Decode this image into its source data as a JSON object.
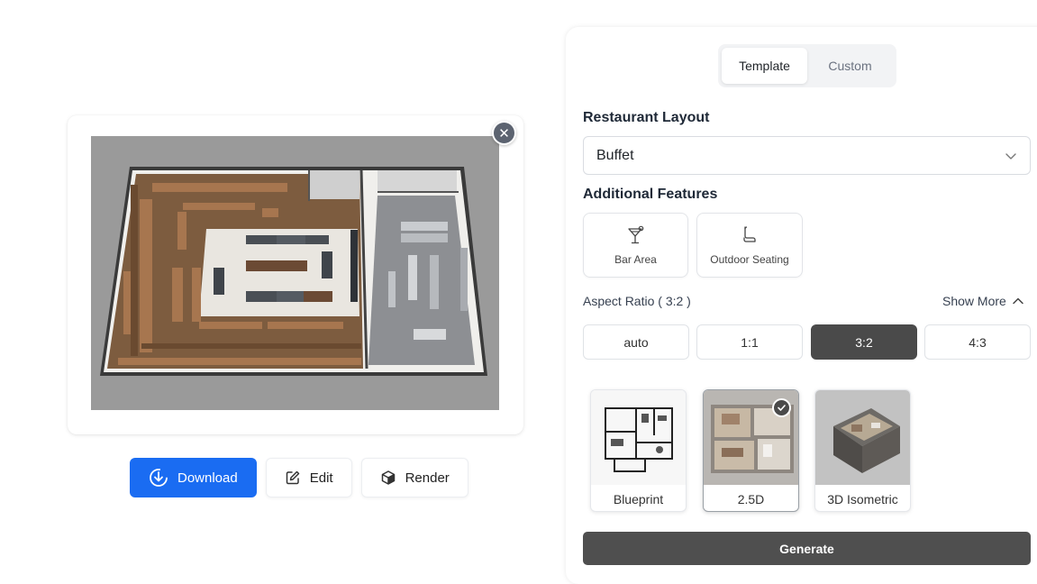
{
  "preview": {
    "image_name": "restaurant-floor-plan-3d-render",
    "close_icon": "close-icon"
  },
  "actions": {
    "download": {
      "label": "Download",
      "icon": "download-icon",
      "color": "#1a6cf2"
    },
    "edit": {
      "label": "Edit",
      "icon": "edit-icon"
    },
    "render": {
      "label": "Render",
      "icon": "cube-icon"
    }
  },
  "tabs": [
    {
      "label": "Template",
      "active": true
    },
    {
      "label": "Custom",
      "active": false
    }
  ],
  "layout_section": {
    "title": "Restaurant Layout",
    "selected": "Buffet",
    "icon": "chevron-down-icon"
  },
  "features_section": {
    "title": "Additional Features",
    "items": [
      {
        "label": "Bar Area",
        "icon": "cocktail-icon"
      },
      {
        "label": "Outdoor Seating",
        "icon": "chair-icon"
      }
    ]
  },
  "aspect_ratio": {
    "label": "Aspect Ratio ( 3:2 )",
    "show_more": "Show More",
    "options": [
      "auto",
      "1:1",
      "3:2",
      "4:3"
    ],
    "selected": "3:2"
  },
  "styles": {
    "items": [
      {
        "label": "Blueprint",
        "thumb": "blueprint-thumbnail"
      },
      {
        "label": "2.5D",
        "thumb": "2-5d-thumbnail",
        "selected": true
      },
      {
        "label": "3D Isometric",
        "thumb": "3d-isometric-thumbnail"
      }
    ]
  },
  "generate": {
    "label": "Generate",
    "color": "#4f4f4f"
  }
}
